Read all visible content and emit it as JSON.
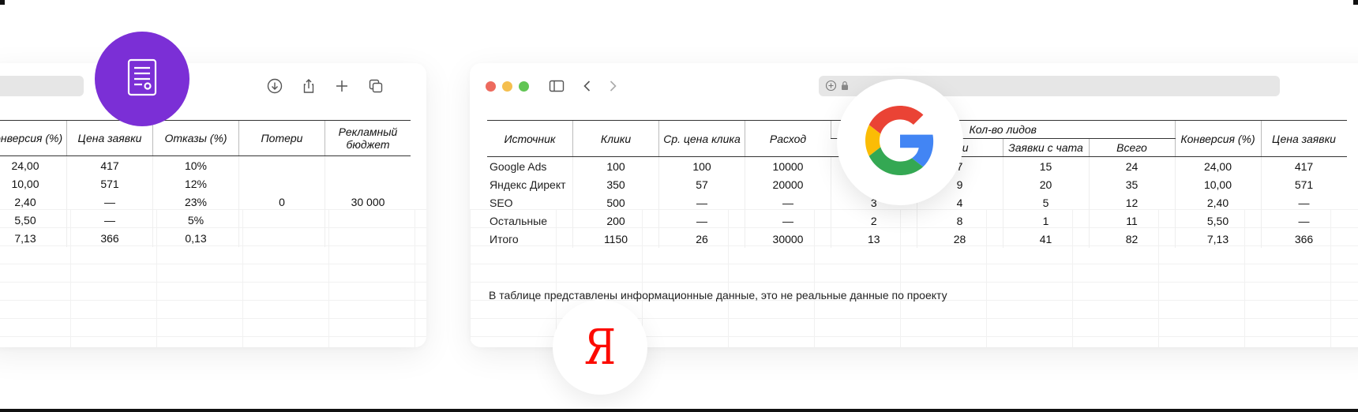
{
  "left_window": {
    "headers": [
      "Конверсия (%)",
      "Цена заявки",
      "Отказы (%)",
      "Потери",
      "Рекламный бюджет"
    ],
    "rows": [
      [
        "24,00",
        "417",
        "10%"
      ],
      [
        "10,00",
        "571",
        "12%"
      ],
      [
        "2,40",
        "—",
        "23%"
      ],
      [
        "5,50",
        "—",
        "5%"
      ],
      [
        "7,13",
        "366",
        "0,13"
      ]
    ],
    "losses": "0",
    "ad_budget": "30 000",
    "icons": [
      "download-icon",
      "share-icon",
      "plus-icon",
      "tabs-icon"
    ]
  },
  "right_window": {
    "headers": {
      "source": "Источник",
      "clicks": "Клики",
      "avg_click_price": "Ср. цена клика",
      "spend": "Расход",
      "leads_group": "Кол-во лидов",
      "leads_calls_partial": "ики",
      "chat_leads": "Заявки с чата",
      "total": "Всего",
      "conversion": "Конверсия (%)",
      "lead_price": "Цена заявки"
    },
    "rows": [
      {
        "source": "Google Ads",
        "clicks": "100",
        "avg": "100",
        "spend": "10000",
        "c1": "",
        "c2": "7",
        "chat": "15",
        "total": "24",
        "conv": "24,00",
        "price": "417"
      },
      {
        "source": "Яндекс Директ",
        "clicks": "350",
        "avg": "57",
        "spend": "20000",
        "c1": "",
        "c2": "9",
        "chat": "20",
        "total": "35",
        "conv": "10,00",
        "price": "571"
      },
      {
        "source": "SEO",
        "clicks": "500",
        "avg": "—",
        "spend": "—",
        "c1": "3",
        "c2": "4",
        "chat": "5",
        "total": "12",
        "conv": "2,40",
        "price": "—"
      },
      {
        "source": "Остальные",
        "clicks": "200",
        "avg": "—",
        "spend": "—",
        "c1": "2",
        "c2": "8",
        "chat": "1",
        "total": "11",
        "conv": "5,50",
        "price": "—"
      },
      {
        "source": "Итого",
        "clicks": "1150",
        "avg": "26",
        "spend": "30000",
        "c1": "13",
        "c2": "28",
        "chat": "41",
        "total": "82",
        "conv": "7,13",
        "price": "366"
      }
    ],
    "note": "В таблице представлены информационные данные, это не реальные данные по проекту",
    "traffic_light_colors": [
      "#ed6a5e",
      "#f5bf4f",
      "#61c554"
    ]
  },
  "badges": {
    "document": "document-icon",
    "google": "google-logo",
    "yandex": "Я"
  },
  "colors": {
    "accent_purple": "#7b2fd6",
    "yandex_red": "#fc0a00",
    "google_blue": "#4285f4",
    "google_red": "#ea4335",
    "google_yellow": "#fbbc05",
    "google_green": "#34a853"
  }
}
